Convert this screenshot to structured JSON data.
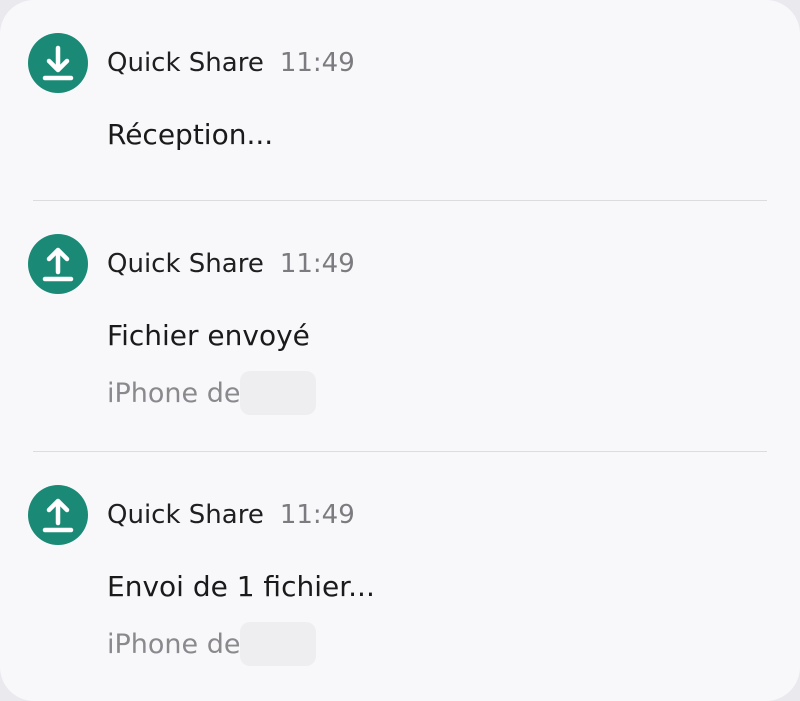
{
  "notifications": [
    {
      "app_name": "Quick Share",
      "time": "11:49",
      "icon": "download-icon",
      "title": "Réception..."
    },
    {
      "app_name": "Quick Share",
      "time": "11:49",
      "icon": "upload-icon",
      "title": "Fichier envoyé",
      "subtitle": "iPhone de"
    },
    {
      "app_name": "Quick Share",
      "time": "11:49",
      "icon": "upload-icon",
      "title": "Envoi de 1 fichier...",
      "subtitle": "iPhone de"
    }
  ],
  "colors": {
    "icon_bg": "#1a8a76",
    "panel_bg": "#f8f8fb",
    "time": "#7c7c80",
    "subtitle": "#8a8a8e"
  }
}
